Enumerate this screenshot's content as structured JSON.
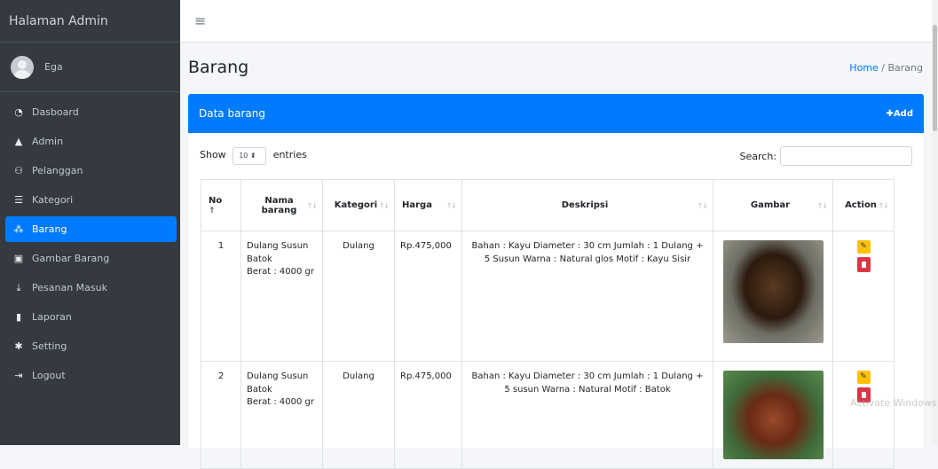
{
  "sidebar": {
    "brand": "Halaman Admin",
    "user": "Ega",
    "items": [
      {
        "label": "Dasboard",
        "icon": "dashboard-icon",
        "glyph": "◔",
        "active": false
      },
      {
        "label": "Admin",
        "icon": "user-icon",
        "glyph": "▲",
        "active": false
      },
      {
        "label": "Pelanggan",
        "icon": "users-icon",
        "glyph": "⚇",
        "active": false
      },
      {
        "label": "Kategori",
        "icon": "list-icon",
        "glyph": "☰",
        "active": false
      },
      {
        "label": "Barang",
        "icon": "cubes-icon",
        "glyph": "⁂",
        "active": true
      },
      {
        "label": "Gambar Barang",
        "icon": "image-icon",
        "glyph": "▣",
        "active": false
      },
      {
        "label": "Pesanan Masuk",
        "icon": "download-icon",
        "glyph": "⤓",
        "active": false
      },
      {
        "label": "Laporan",
        "icon": "file-icon",
        "glyph": "▮",
        "active": false
      },
      {
        "label": "Setting",
        "icon": "gear-icon",
        "glyph": "✱",
        "active": false
      },
      {
        "label": "Logout",
        "icon": "sign-out-icon",
        "glyph": "⇥",
        "active": false
      }
    ]
  },
  "topbar": {
    "menu_icon": "hamburger-icon",
    "menu_glyph": "≡"
  },
  "page": {
    "title": "Barang",
    "breadcrumb": {
      "home": "Home",
      "separator": " / ",
      "current": "Barang"
    }
  },
  "card": {
    "title": "Data barang",
    "add_label": "Add",
    "add_glyph": "✚"
  },
  "controls": {
    "show_label": "Show",
    "entries_value": "10",
    "entries_label": "entries",
    "search_label": "Search:"
  },
  "table": {
    "headers": [
      "No",
      "Nama barang",
      "Kategori",
      "Harga",
      "Deskripsi",
      "Gambar",
      "Action"
    ],
    "rows": [
      {
        "no": "1",
        "name": "Dulang Susun Batok",
        "weight": "Berat : 4000 gr",
        "category": "Dulang",
        "price": "Rp.475,000",
        "description": "Bahan : Kayu Diameter : 30 cm Jumlah : 1 Dulang + 5 Susun Warna : Natural glos Motif : Kayu Sisir"
      },
      {
        "no": "2",
        "name": "Dulang Susun Batok",
        "weight": "Berat : 4000 gr",
        "category": "Dulang",
        "price": "Rp.475,000",
        "description": "Bahan : Kayu Diameter : 30 cm Jumlah : 1 Dulang + 5 susun Warna : Natural Motif : Batok"
      }
    ]
  },
  "colors": {
    "primary": "#007bff",
    "sidebar": "#343a40",
    "edit": "#ffc107",
    "delete": "#dc3545"
  },
  "watermark": "Activate Windows"
}
